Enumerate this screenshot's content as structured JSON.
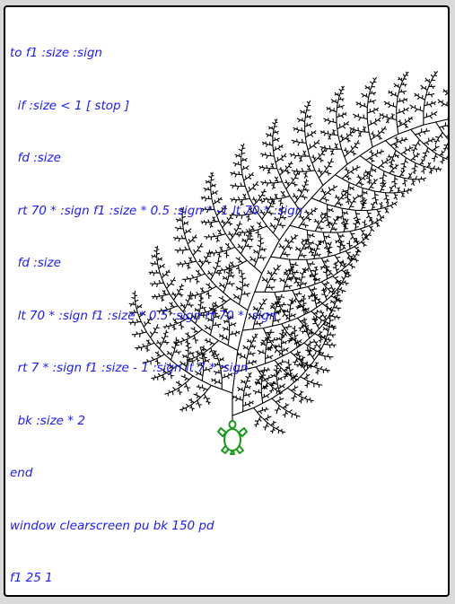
{
  "program": {
    "lines": [
      "to f1 :size :sign",
      "  if :size < 1 [ stop ]",
      "  fd :size",
      "  rt 70 * :sign f1 :size * 0.5 :sign * -1 lt 70 * :sign",
      "  fd :size",
      "  lt 70 * :sign f1 :size * 0.5 :sign rt 70 * :sign",
      "  rt 7 * :sign f1 :size - 1 :sign lt 7 * :sign",
      "  bk :size * 2",
      "end",
      "window clearscreen pu bk 150 pd",
      "f1 25 1"
    ]
  },
  "turtle": {
    "icon": "turtle-icon",
    "color": "#1a9a1a"
  },
  "colors": {
    "code": "#1a1aff",
    "drawing": "#000000",
    "background": "#ffffff"
  }
}
